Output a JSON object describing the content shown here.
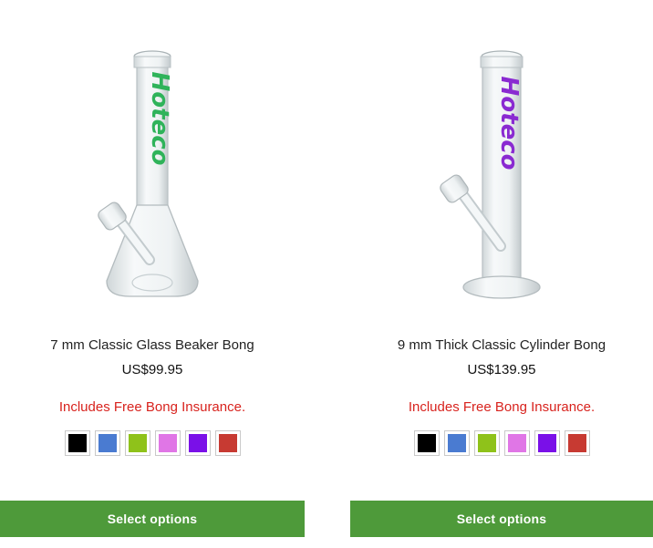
{
  "products": [
    {
      "title": "7 mm Classic Glass Beaker Bong",
      "price": "US$99.95",
      "insurance_note": "Includes Free Bong Insurance.",
      "button_label": "Select options",
      "logo_text": "Hoteco",
      "logo_color": "#2fb35a",
      "swatches": [
        "#000000",
        "#4a7bd1",
        "#8fc21a",
        "#e076e6",
        "#7a10e8",
        "#c73a32"
      ]
    },
    {
      "title": "9 mm Thick Classic Cylinder Bong",
      "price": "US$139.95",
      "insurance_note": "Includes Free Bong Insurance.",
      "button_label": "Select options",
      "logo_text": "Hoteco",
      "logo_color": "#8a2ad1",
      "swatches": [
        "#000000",
        "#4a7bd1",
        "#8fc21a",
        "#e076e6",
        "#7a10e8",
        "#c73a32"
      ]
    }
  ]
}
